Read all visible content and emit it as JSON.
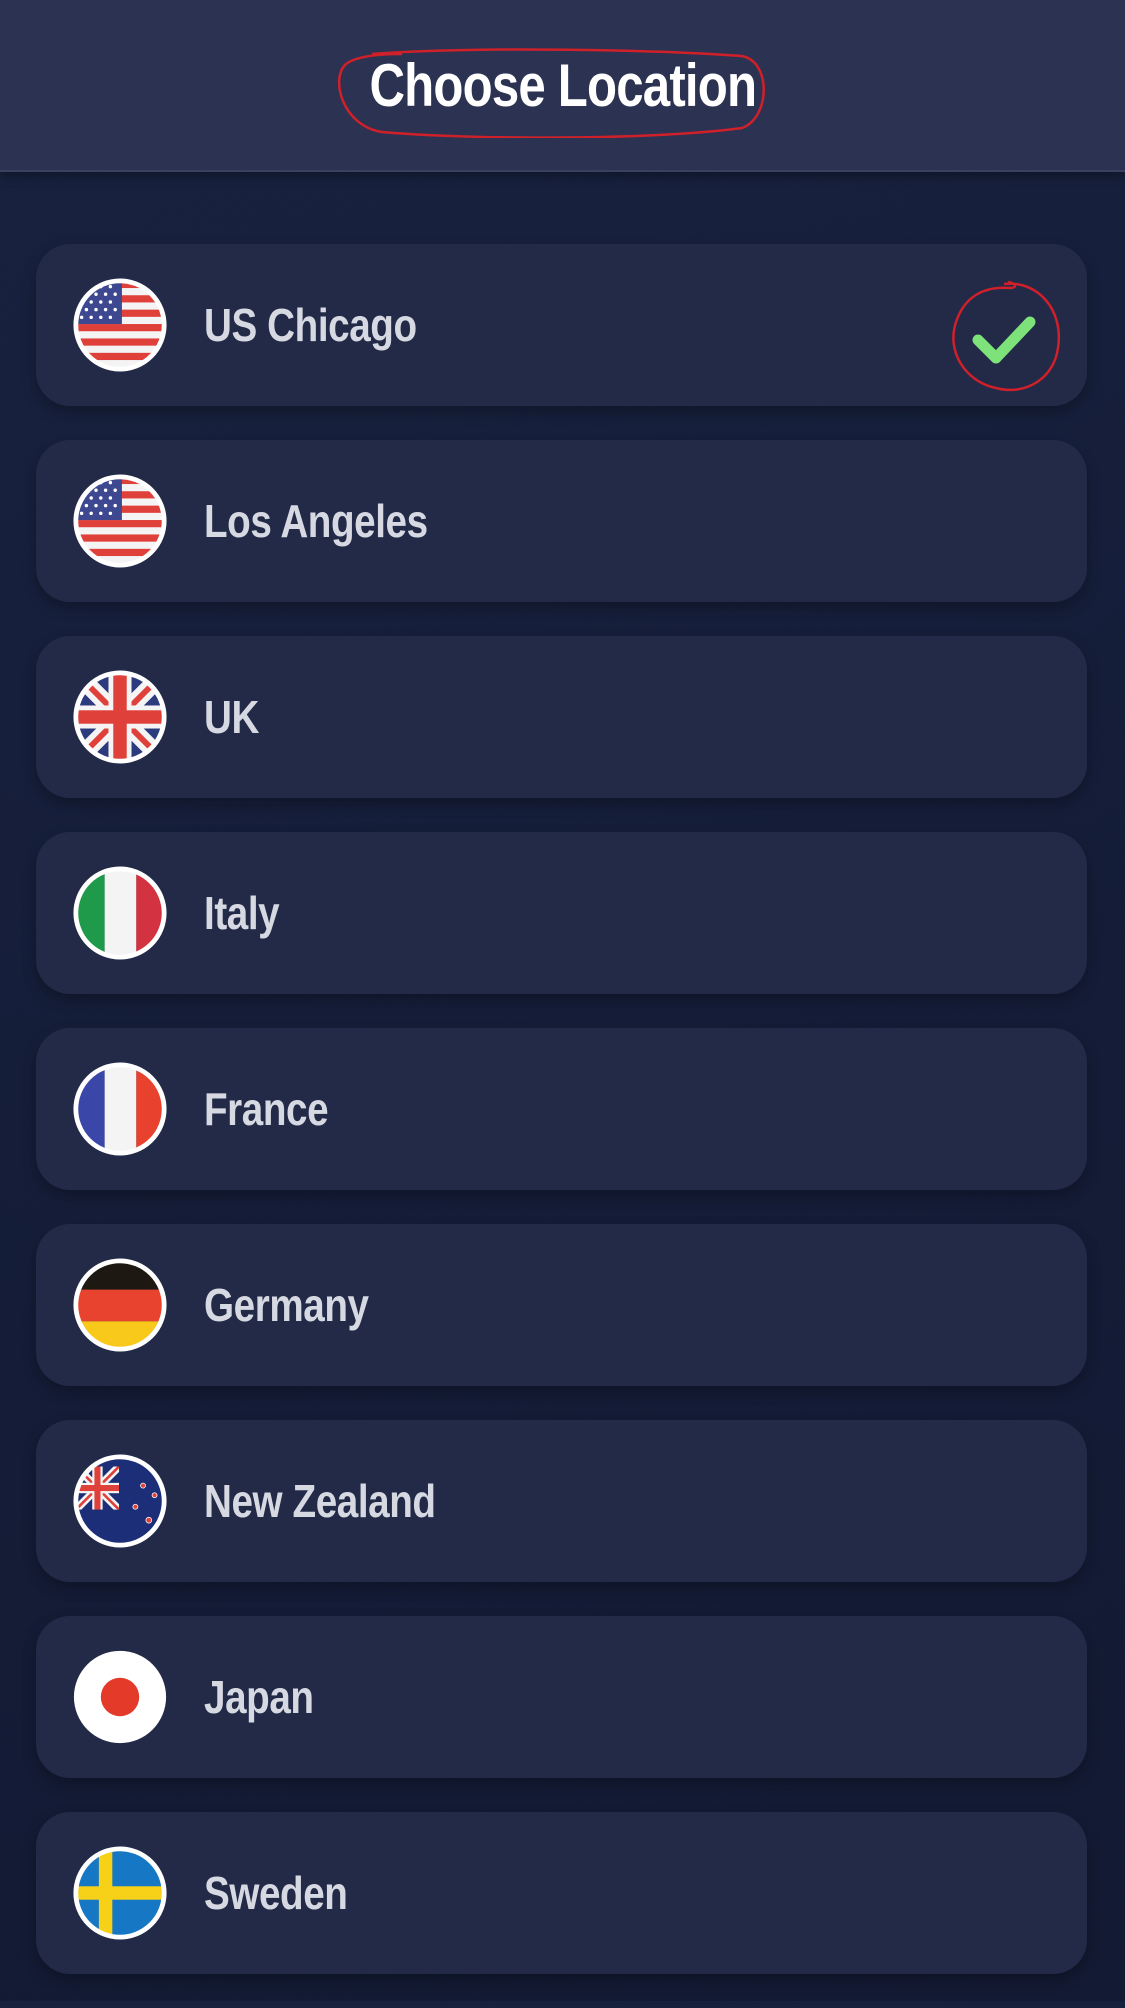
{
  "header": {
    "title": "Choose Location"
  },
  "locations": [
    {
      "label": "US Chicago",
      "flag_icon": "us-flag-icon",
      "selected": true
    },
    {
      "label": "Los Angeles",
      "flag_icon": "us-flag-icon",
      "selected": false
    },
    {
      "label": "UK",
      "flag_icon": "uk-flag-icon",
      "selected": false
    },
    {
      "label": "Italy",
      "flag_icon": "italy-flag-icon",
      "selected": false
    },
    {
      "label": "France",
      "flag_icon": "france-flag-icon",
      "selected": false
    },
    {
      "label": "Germany",
      "flag_icon": "germany-flag-icon",
      "selected": false
    },
    {
      "label": "New Zealand",
      "flag_icon": "new-zealand-flag-icon",
      "selected": false
    },
    {
      "label": "Japan",
      "flag_icon": "japan-flag-icon",
      "selected": false
    },
    {
      "label": "Sweden",
      "flag_icon": "sweden-flag-icon",
      "selected": false
    }
  ],
  "colors": {
    "background": "#151e3b",
    "header": "#2b3252",
    "card": "#222a48",
    "label": "#d7d9e2",
    "check": "#7de27a",
    "annotation": "#d0202a"
  }
}
